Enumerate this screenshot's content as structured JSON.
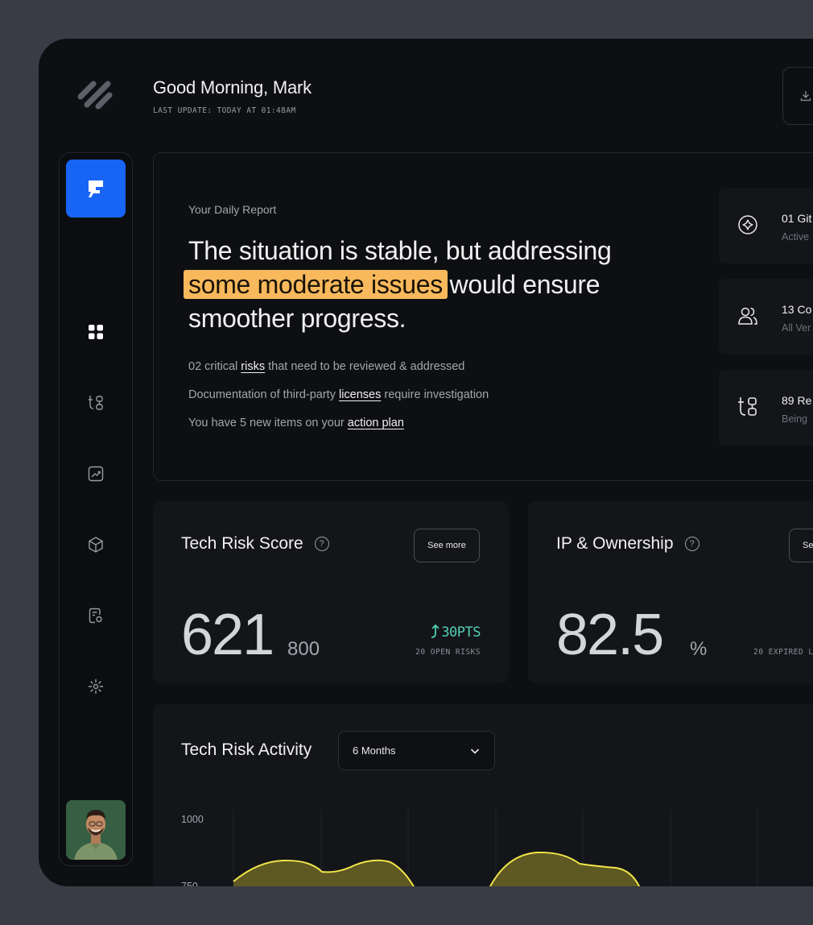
{
  "header": {
    "greeting": "Good Morning, Mark",
    "last_update": "LAST UPDATE: TODAY AT 01:48AM"
  },
  "sidebar": {
    "items": [
      {
        "icon": "grid-icon"
      },
      {
        "icon": "branch-icon"
      },
      {
        "icon": "chart-trend-icon"
      },
      {
        "icon": "cube-icon"
      },
      {
        "icon": "document-icon"
      },
      {
        "icon": "sun-icon"
      }
    ]
  },
  "report": {
    "label": "Your Daily Report",
    "headline_before": "The situation is stable, but addressing ",
    "headline_highlight": "some moderate issues",
    "headline_after": " would ensure smoother progress.",
    "bullets": [
      {
        "before": "02 critical ",
        "link": "risks",
        "after": " that need to be reviewed & addressed"
      },
      {
        "before": "Documentation of third-party ",
        "link": "licenses",
        "after": " require investigation"
      },
      {
        "before": "You have 5 new items on your ",
        "link": "action plan",
        "after": ""
      }
    ],
    "stats": [
      {
        "icon": "compass-icon",
        "title": "01 Git",
        "desc": "Active"
      },
      {
        "icon": "users-icon",
        "title": "13 Co",
        "desc": "All Ver"
      },
      {
        "icon": "branch-icon",
        "title": "89 Re",
        "desc": "Being"
      }
    ]
  },
  "cards": {
    "tech_risk": {
      "title": "Tech Risk Score",
      "help": "?",
      "see_more": "See more",
      "value": "621",
      "max": "800",
      "change": "30PTS",
      "open_risks": "20 OPEN RISKS"
    },
    "ip": {
      "title": "IP & Ownership",
      "help": "?",
      "see_more": "Se",
      "value": "82.5",
      "unit": "%",
      "expired": "20 EXPIRED L"
    }
  },
  "activity": {
    "title": "Tech Risk Activity",
    "range_value": "6 Months",
    "y_ticks": [
      "1000",
      "750"
    ]
  },
  "colors": {
    "accent_blue": "#1764f5",
    "highlight_orange": "#f8b95c",
    "positive_teal": "#4fd1b5",
    "chart_yellow": "#f1e64a"
  }
}
